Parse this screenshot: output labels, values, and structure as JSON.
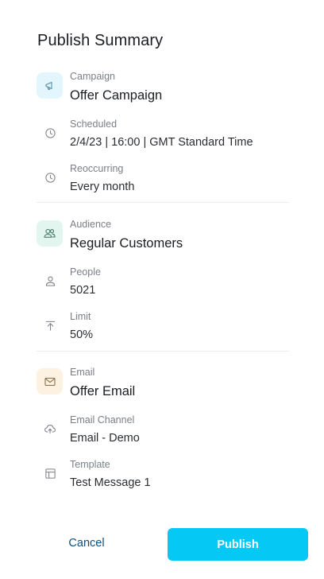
{
  "title": "Publish Summary",
  "colors": {
    "accent": "#06c8f4",
    "campaign_tile": "#e3f6fd",
    "audience_tile": "#e2f5ee",
    "email_tile": "#fdf1e1"
  },
  "campaign": {
    "label": "Campaign",
    "value": "Offer Campaign",
    "icon": "megaphone-icon",
    "scheduled": {
      "label": "Scheduled",
      "value": "2/4/23 | 16:00 | GMT Standard Time",
      "icon": "clock-icon"
    },
    "reoccurring": {
      "label": "Reoccurring",
      "value": "Every month",
      "icon": "clock-icon"
    }
  },
  "audience": {
    "label": "Audience",
    "value": "Regular Customers",
    "icon": "users-icon",
    "people": {
      "label": "People",
      "value": "5021",
      "icon": "user-icon"
    },
    "limit": {
      "label": "Limit",
      "value": "50%",
      "icon": "upload-limit-icon"
    }
  },
  "email": {
    "label": "Email",
    "value": "Offer Email",
    "icon": "envelope-icon",
    "channel": {
      "label": "Email Channel",
      "value": "Email - Demo",
      "icon": "cloud-upload-icon"
    },
    "template": {
      "label": "Template",
      "value": "Test Message 1",
      "icon": "template-icon"
    }
  },
  "actions": {
    "cancel_label": "Cancel",
    "publish_label": "Publish"
  }
}
